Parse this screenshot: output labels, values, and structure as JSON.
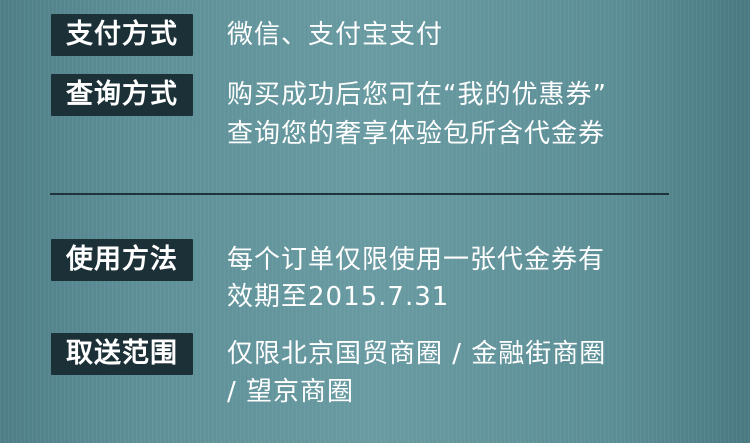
{
  "sections": [
    {
      "label": "支付方式",
      "lines": [
        "微信、支付宝支付"
      ]
    },
    {
      "label": "查询方式",
      "lines": [
        "购买成功后您可在“我的优惠券”",
        "查询您的奢享体验包所含代金券"
      ]
    },
    {
      "label": "使用方法",
      "lines": [
        "每个订单仅限使用一张代金券有",
        "效期至2015.7.31"
      ]
    },
    {
      "label": "取送范围",
      "lines": [
        "仅限北京国贸商圈 / 金融街商圈",
        " / 望京商圈"
      ]
    }
  ]
}
